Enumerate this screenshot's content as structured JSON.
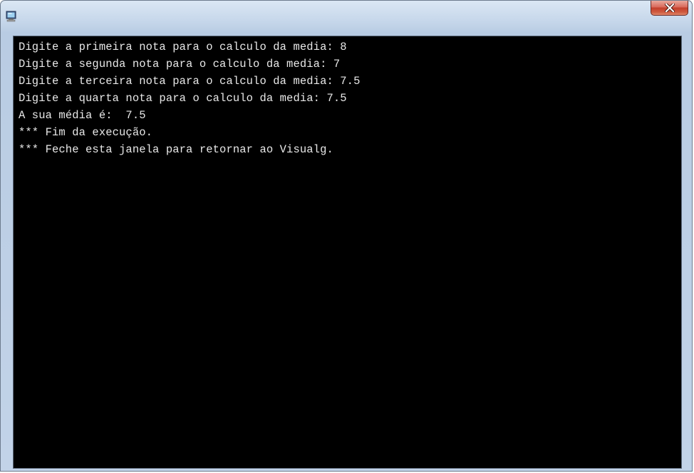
{
  "window": {
    "icon": "console-app-icon",
    "close_icon": "close-icon",
    "colors": {
      "console_background": "#000000",
      "console_text": "#e8e8e8",
      "close_button": "#c33f2d"
    }
  },
  "console": {
    "lines": [
      "Digite a primeira nota para o calculo da media: 8",
      "Digite a segunda nota para o calculo da media: 7",
      "Digite a terceira nota para o calculo da media: 7.5",
      "Digite a quarta nota para o calculo da media: 7.5",
      "A sua média é:  7.5",
      "*** Fim da execução.",
      "*** Feche esta janela para retornar ao Visualg."
    ]
  }
}
